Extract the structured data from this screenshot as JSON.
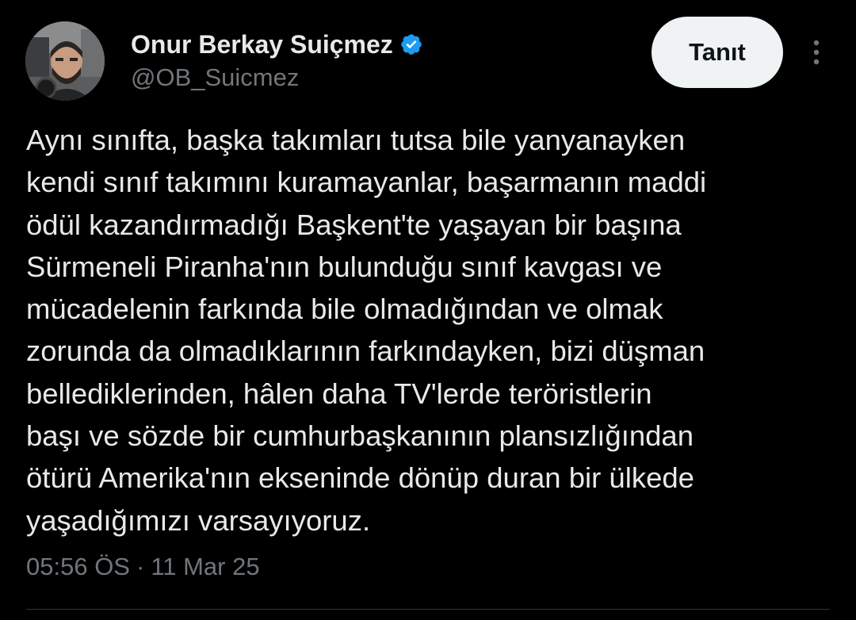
{
  "author": {
    "display_name": "Onur Berkay Suiçmez",
    "handle": "@OB_Suicmez",
    "avatar_icon": "profile-photo",
    "verified_icon": "verified-badge-icon",
    "verified_color": "#1d9bf0"
  },
  "actions": {
    "follow_label": "Tanıt",
    "more_icon": "more-vertical-icon"
  },
  "tweet": {
    "text": "Aynı sınıfta, başka takımları tutsa bile yanyanayken\nkendi sınıf takımını kuramayanlar, başarmanın maddi\nödül kazandırmadığı Başkent'te yaşayan bir başına\nSürmeneli Piranha'nın bulunduğu sınıf kavgası ve\nmücadelenin farkında bile olmadığından ve olmak\nzorunda da olmadıklarının farkındayken, bizi düşman\nbellediklerinden, hâlen daha TV'lerde teröristlerin\nbaşı ve sözde bir cumhurbaşkanının plansızlığından\nötürü Amerika'nın ekseninde dönüp duran bir ülkede\nyaşadığımızı varsayıyoruz.",
    "time": "05:56 ÖS",
    "separator": "·",
    "date": "11 Mar 25"
  },
  "colors": {
    "background": "#000000",
    "primary_text": "#e7e9ea",
    "secondary_text": "#71767b",
    "button_bg": "#eff3f4"
  }
}
